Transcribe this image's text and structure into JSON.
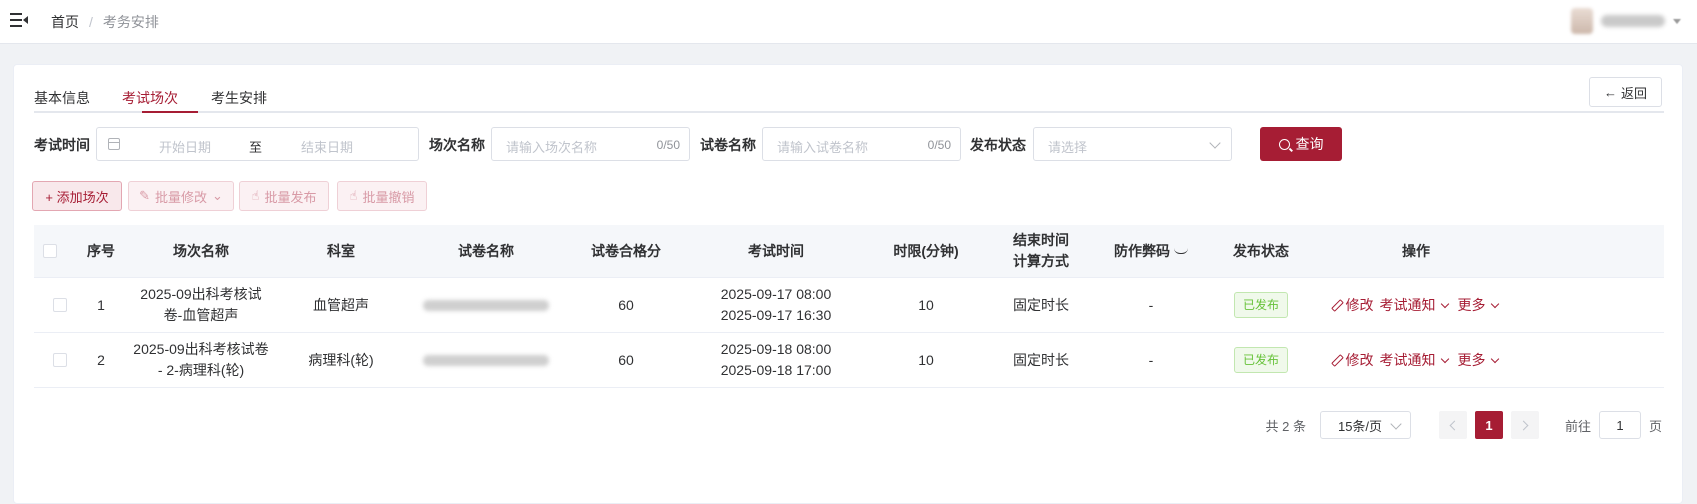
{
  "header": {
    "breadcrumb": {
      "home": "首页",
      "separator": "/",
      "current": "考务安排"
    }
  },
  "tabs": [
    {
      "label": "基本信息"
    },
    {
      "label": "考试场次"
    },
    {
      "label": "考生安排"
    }
  ],
  "back_button": {
    "icon": "arrow-left-icon",
    "label": "返回"
  },
  "filters": {
    "exam_time_label": "考试时间",
    "start_placeholder": "开始日期",
    "range_separator": "至",
    "end_placeholder": "结束日期",
    "session_name_label": "场次名称",
    "session_name_placeholder": "请输入场次名称",
    "session_name_count": "0/50",
    "paper_name_label": "试卷名称",
    "paper_name_placeholder": "请输入试卷名称",
    "paper_name_count": "0/50",
    "publish_status_label": "发布状态",
    "publish_status_placeholder": "请选择",
    "query_button": "查询"
  },
  "actions": {
    "add": "+ 添加场次",
    "batch_edit": "批量修改",
    "batch_publish": "批量发布",
    "batch_revoke": "批量撤销"
  },
  "table": {
    "headers": {
      "index": "序号",
      "session_name": "场次名称",
      "department": "科室",
      "paper_name": "试卷名称",
      "pass_score": "试卷合格分",
      "exam_time": "考试时间",
      "time_limit": "时限(分钟)",
      "end_calc_line1": "结束时间",
      "end_calc_line2": "计算方式",
      "anti_cheat": "防作弊码",
      "status": "发布状态",
      "operations": "操作"
    },
    "rows": [
      {
        "index": "1",
        "session_name_line1": "2025-09出科考核试",
        "session_name_line2": "卷-血管超声",
        "department": "血管超声",
        "pass_score": "60",
        "exam_start": "2025-09-17 08:00",
        "exam_end": "2025-09-17 16:30",
        "time_limit": "10",
        "end_calc": "固定时长",
        "anti_cheat": "-",
        "status": "已发布",
        "op_edit": "修改",
        "op_notice": "考试通知",
        "op_more": "更多"
      },
      {
        "index": "2",
        "session_name_line1": "2025-09出科考核试卷",
        "session_name_line2": "- 2-病理科(轮)",
        "department": "病理科(轮)",
        "pass_score": "60",
        "exam_start": "2025-09-18 08:00",
        "exam_end": "2025-09-18 17:00",
        "time_limit": "10",
        "end_calc": "固定时长",
        "anti_cheat": "-",
        "status": "已发布",
        "op_edit": "修改",
        "op_notice": "考试通知",
        "op_more": "更多"
      }
    ]
  },
  "pagination": {
    "total": "共 2 条",
    "page_size": "15条/页",
    "current_page": "1",
    "goto_prefix": "前往",
    "goto_value": "1",
    "goto_suffix": "页"
  },
  "colors": {
    "accent": "#a61d34",
    "success": "#67c23a"
  }
}
